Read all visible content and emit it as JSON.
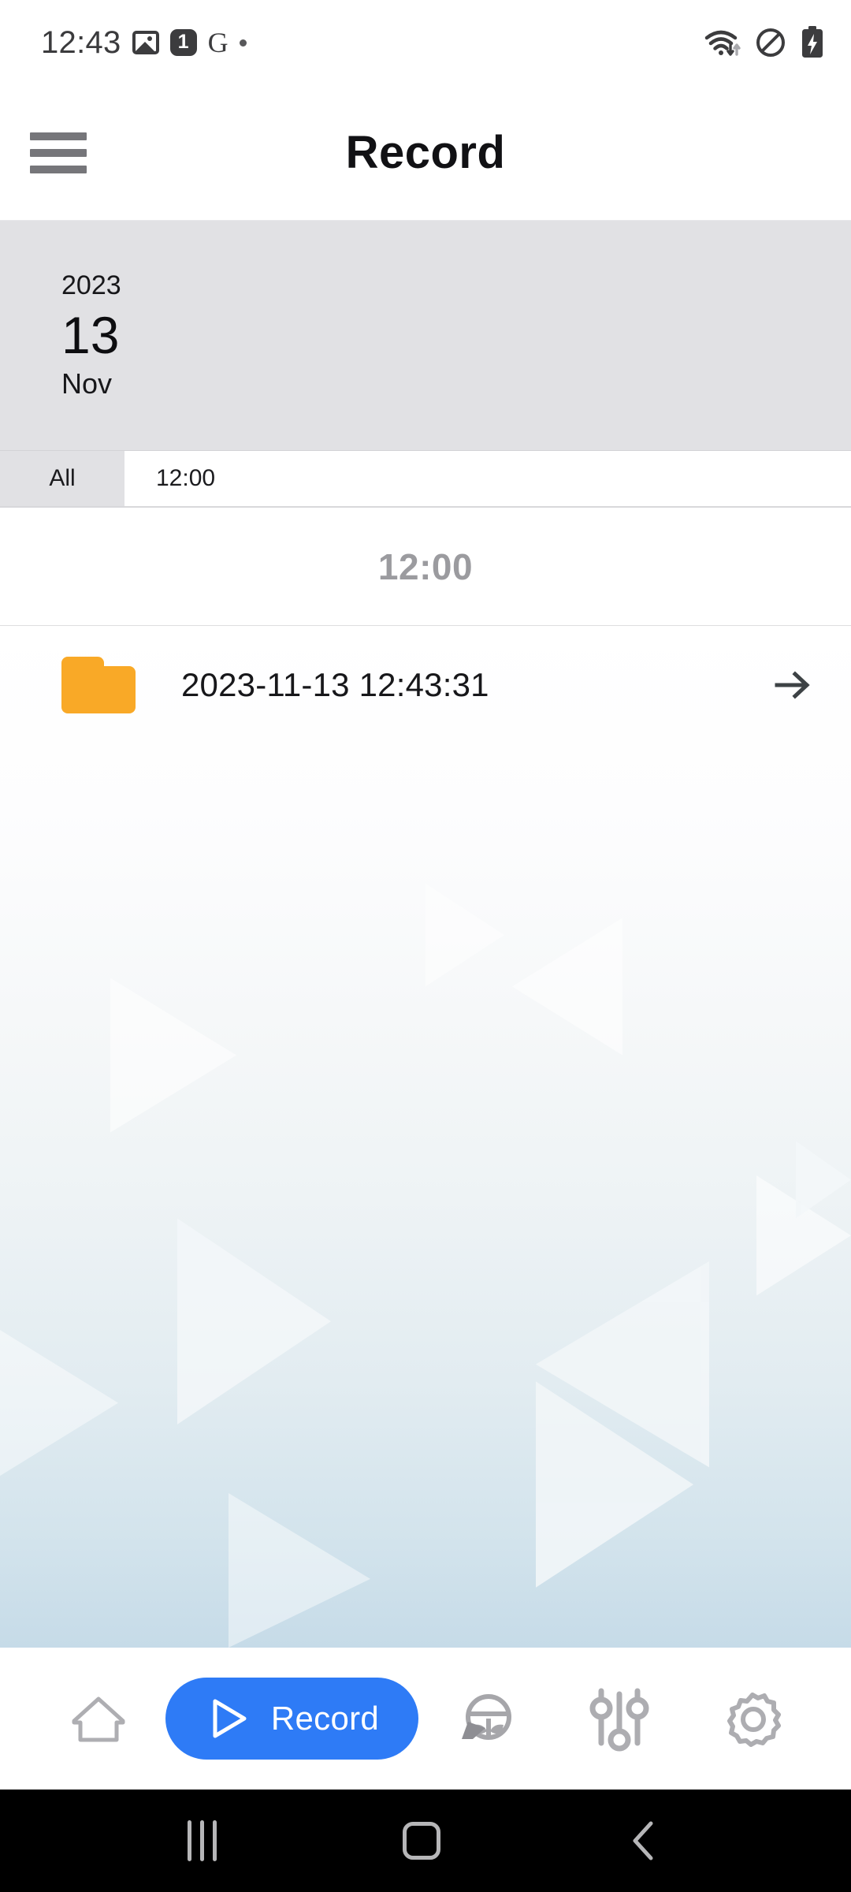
{
  "status_bar": {
    "time": "12:43",
    "notification_badge": "1",
    "google_glyph": "G",
    "icons": [
      "image-icon",
      "notification-count-badge",
      "google-icon",
      "dot-icon",
      "wifi-icon",
      "do-not-disturb-icon",
      "battery-charging-icon"
    ]
  },
  "app_bar": {
    "menu_icon": "hamburger-menu-icon",
    "title": "Record"
  },
  "date_card": {
    "year": "2023",
    "day": "13",
    "month": "Nov"
  },
  "tabs": [
    {
      "label": "All",
      "selected": false
    },
    {
      "label": "12:00",
      "selected": true
    }
  ],
  "group_header": {
    "label": "12:00"
  },
  "file_list": [
    {
      "icon": "folder-icon",
      "name": "2023-11-13 12:43:31",
      "chevron": "arrow-right-icon"
    }
  ],
  "bottom_nav": {
    "items": [
      {
        "name": "home",
        "icon": "home-icon",
        "label": "",
        "active": false
      },
      {
        "name": "record",
        "icon": "play-icon",
        "label": "Record",
        "active": true
      },
      {
        "name": "driving",
        "icon": "steering-wheel-icon",
        "label": "",
        "active": false
      },
      {
        "name": "tune",
        "icon": "sliders-icon",
        "label": "",
        "active": false
      },
      {
        "name": "settings",
        "icon": "gear-icon",
        "label": "",
        "active": false
      }
    ]
  },
  "android_nav": {
    "recents": "recents-icon",
    "home": "home-square-icon",
    "back": "back-chevron-icon"
  },
  "colors": {
    "accent_blue": "#2e7bf6",
    "folder_orange": "#f9a927",
    "date_card_bg": "#e1e1e4",
    "group_header_text": "#9b9b9f",
    "bg_gradient_bottom": "#c6dbe8"
  }
}
